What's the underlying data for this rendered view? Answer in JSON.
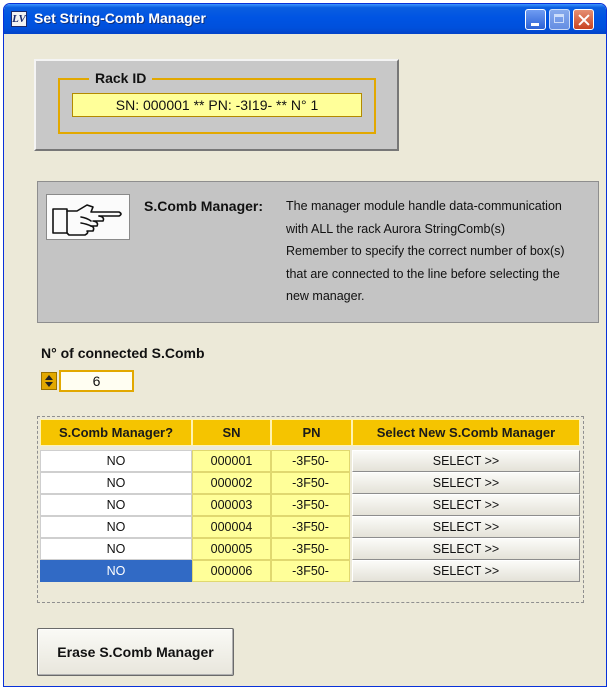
{
  "window": {
    "title": "Set String-Comb Manager"
  },
  "rack": {
    "label": "Rack ID",
    "value": "SN: 000001 ** PN: -3I19- ** N° 1"
  },
  "manager_info": {
    "title": "S.Comb Manager:",
    "lines": [
      "The manager module handle data-communication",
      "with ALL the rack Aurora StringComb(s)",
      "Remember to specify the correct number of box(s)",
      "that are connected to the line before selecting the",
      "new manager."
    ]
  },
  "connected": {
    "label": "N° of connected S.Comb",
    "value": "6"
  },
  "table": {
    "headers": [
      "S.Comb Manager?",
      "SN",
      "PN",
      "Select New S.Comb Manager"
    ],
    "rows": [
      {
        "manager": "NO",
        "sn": "000001",
        "pn": "-3F50-",
        "action": "SELECT >>"
      },
      {
        "manager": "NO",
        "sn": "000002",
        "pn": "-3F50-",
        "action": "SELECT >>"
      },
      {
        "manager": "NO",
        "sn": "000003",
        "pn": "-3F50-",
        "action": "SELECT >>"
      },
      {
        "manager": "NO",
        "sn": "000004",
        "pn": "-3F50-",
        "action": "SELECT >>"
      },
      {
        "manager": "NO",
        "sn": "000005",
        "pn": "-3F50-",
        "action": "SELECT >>"
      },
      {
        "manager": "NO",
        "sn": "000006",
        "pn": "-3F50-",
        "action": "SELECT >>"
      }
    ],
    "selected_row": 5
  },
  "erase_button": {
    "label": "Erase S.Comb Manager"
  },
  "icons": {
    "app": "labview-app-icon",
    "hand": "pointing-hand-icon"
  },
  "colors": {
    "header_yellow": "#f5c400",
    "cell_yellow": "#ffff99",
    "selection_blue": "#316ac5",
    "titlebar_blue": "#0054e3"
  }
}
